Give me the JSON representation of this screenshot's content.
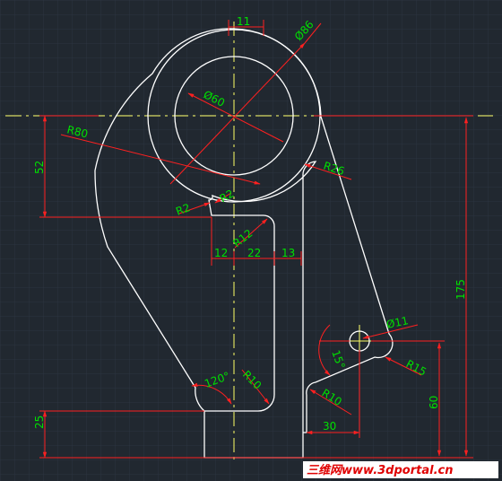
{
  "drawing": {
    "dimensions": {
      "d11_top": "11",
      "dia86": "Ø86",
      "dia60": "Ø60",
      "r80": "R80",
      "d52": "52",
      "r26": "R26",
      "r2_left": "R2",
      "r2_right": "R2",
      "r12": "R12",
      "d12": "12",
      "d22": "22",
      "d13": "13",
      "d175": "175",
      "dia11": "Ø11",
      "ang15": "15°",
      "r15": "R15",
      "ang120": "120°",
      "r10_inner": "R10",
      "r10_lower": "R10",
      "d60": "60",
      "d25": "25",
      "d30": "30"
    },
    "colors": {
      "background": "#212830",
      "grid": "#2c3440",
      "outline": "#ffffff",
      "centerline": "#ffff66",
      "dimension_line": "#ff2020",
      "dimension_text": "#00e000"
    }
  },
  "watermark": {
    "text": "三维网www.3dportal.cn"
  }
}
